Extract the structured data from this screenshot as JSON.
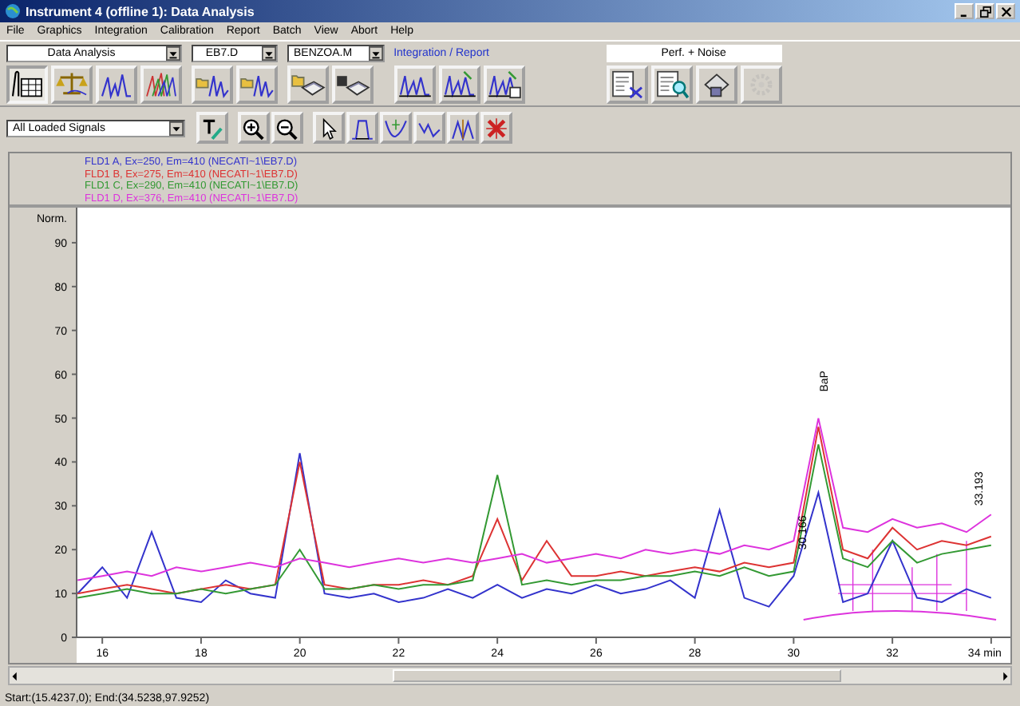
{
  "window": {
    "title": "Instrument 4 (offline 1): Data Analysis"
  },
  "menu": [
    "File",
    "Graphics",
    "Integration",
    "Calibration",
    "Report",
    "Batch",
    "View",
    "Abort",
    "Help"
  ],
  "toolbar": [
    {
      "kind": "dropdown",
      "value": "Data Analysis",
      "buttons": [
        {
          "pressed": true,
          "disabled": false
        },
        {
          "pressed": false,
          "disabled": false
        },
        {
          "pressed": false,
          "disabled": false
        },
        {
          "pressed": false,
          "disabled": false
        }
      ]
    },
    {
      "kind": "dropdown",
      "value": "EB7.D",
      "buttons": [
        {
          "pressed": false,
          "disabled": false
        },
        {
          "pressed": false,
          "disabled": false
        }
      ]
    },
    {
      "kind": "dropdown",
      "value": "BENZOA.M",
      "buttons": [
        {
          "pressed": false,
          "disabled": false
        },
        {
          "pressed": false,
          "disabled": false
        }
      ]
    },
    {
      "kind": "label",
      "value": "Integration / Report",
      "buttons": [
        {
          "pressed": false,
          "disabled": false
        },
        {
          "pressed": false,
          "disabled": false
        },
        {
          "pressed": false,
          "disabled": false
        }
      ]
    },
    {
      "kind": "field",
      "value": "Perf. + Noise",
      "buttons": [
        {
          "pressed": false,
          "disabled": false
        },
        {
          "pressed": false,
          "disabled": false
        },
        {
          "pressed": false,
          "disabled": false
        },
        {
          "pressed": false,
          "disabled": true
        }
      ]
    }
  ],
  "toolbar2": {
    "signal_select": {
      "value": "All Loaded Signals"
    },
    "buttons": [
      {
        "pressed": false
      },
      {
        "pressed": false
      },
      {
        "pressed": false
      },
      {
        "pressed": false
      },
      {
        "pressed": false
      },
      {
        "pressed": false
      },
      {
        "pressed": false
      },
      {
        "pressed": false
      },
      {
        "pressed": false
      }
    ]
  },
  "chart": {
    "signals": [
      {
        "text": "FLD1 A, Ex=250, Em=410 (NECATI~1\\EB7.D)",
        "color": "#3333cc"
      },
      {
        "text": "FLD1 B, Ex=275, Em=410 (NECATI~1\\EB7.D)",
        "color": "#dd3333"
      },
      {
        "text": "FLD1 C, Ex=290, Em=410 (NECATI~1\\EB7.D)",
        "color": "#339933"
      },
      {
        "text": "FLD1 D, Ex=376, Em=410 (NECATI~1\\EB7.D)",
        "color": "#dd33dd"
      }
    ],
    "chart_data": {
      "type": "line",
      "ylabel": "Norm.",
      "xlim": [
        15.48,
        34.39
      ],
      "ylim": [
        0,
        98
      ],
      "x": [
        15.5,
        16,
        16.5,
        17,
        17.5,
        18,
        18.5,
        19,
        19.5,
        20,
        20.5,
        21,
        21.5,
        22,
        22.5,
        23,
        23.5,
        24,
        24.5,
        25,
        25.5,
        26,
        26.5,
        27,
        27.5,
        28,
        28.5,
        29,
        29.5,
        30,
        30.5,
        31,
        31.5,
        32,
        32.5,
        33,
        33.5,
        34
      ],
      "series": [
        {
          "color": "#3333cc",
          "values": [
            10,
            16,
            9,
            24,
            9,
            8,
            13,
            10,
            9,
            42,
            10,
            9,
            10,
            8,
            9,
            11,
            9,
            12,
            9,
            11,
            10,
            12,
            10,
            11,
            13,
            9,
            29,
            9,
            7,
            14,
            33,
            8,
            10,
            22,
            9,
            8,
            11,
            9
          ]
        },
        {
          "color": "#dd3333",
          "values": [
            10,
            11,
            12,
            11,
            10,
            11,
            12,
            11,
            12,
            40,
            12,
            11,
            12,
            12,
            13,
            12,
            14,
            27,
            13,
            22,
            14,
            14,
            15,
            14,
            15,
            16,
            15,
            17,
            16,
            17,
            48,
            20,
            18,
            25,
            20,
            22,
            21,
            23
          ]
        },
        {
          "color": "#339933",
          "values": [
            9,
            10,
            11,
            10,
            10,
            11,
            10,
            11,
            12,
            20,
            11,
            11,
            12,
            11,
            12,
            12,
            13,
            37,
            12,
            13,
            12,
            13,
            13,
            14,
            14,
            15,
            14,
            16,
            14,
            15,
            44,
            18,
            16,
            22,
            17,
            19,
            20,
            21
          ]
        },
        {
          "color": "#dd33dd",
          "values": [
            13,
            14,
            15,
            14,
            16,
            15,
            16,
            17,
            16,
            18,
            17,
            16,
            17,
            18,
            17,
            18,
            17,
            18,
            19,
            17,
            18,
            19,
            18,
            20,
            19,
            20,
            19,
            21,
            20,
            22,
            50,
            25,
            24,
            27,
            25,
            26,
            24,
            28
          ]
        }
      ],
      "xticks": [
        16,
        18,
        20,
        22,
        24,
        26,
        28,
        30,
        32,
        {
          "value": 34,
          "label": "34 min"
        }
      ],
      "yticks": [
        0,
        10,
        20,
        30,
        40,
        50,
        60,
        70,
        80,
        90
      ]
    },
    "peak_labels": [
      "30.166",
      "BaP",
      "33.193"
    ]
  },
  "status_bar": "Start:(15.4237,0); End:(34.5238,97.9252)"
}
